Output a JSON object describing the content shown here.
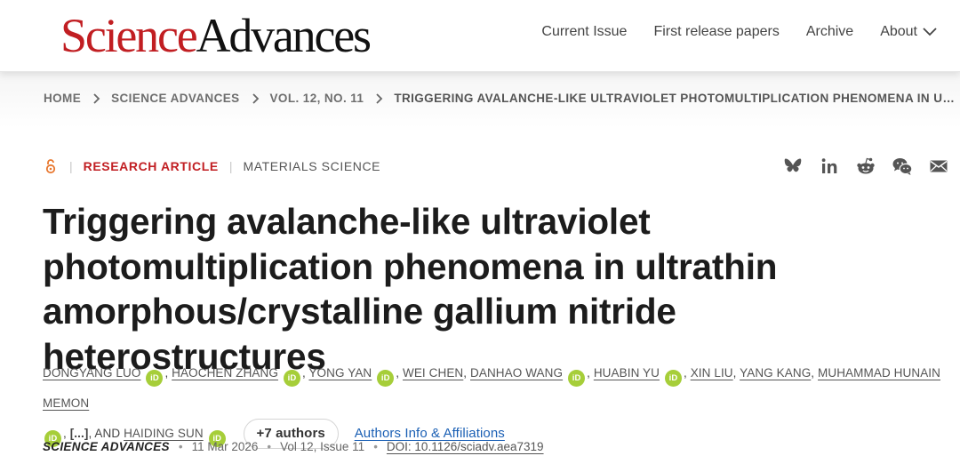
{
  "header": {
    "logo_part1": "Science",
    "logo_part2": "Advances",
    "nav": [
      "Current Issue",
      "First release papers",
      "Archive",
      "About"
    ],
    "brand_color": "#c11e22"
  },
  "breadcrumb": {
    "items": [
      "HOME",
      "SCIENCE ADVANCES",
      "VOL. 12, NO. 11",
      "TRIGGERING AVALANCHE-LIKE ULTRAVIOLET PHOTOMULTIPLICATION PHENOMENA IN ULTRATHIN…"
    ]
  },
  "article": {
    "access_icon": "open-access-icon",
    "type": "RESEARCH ARTICLE",
    "subject": "MATERIALS SCIENCE",
    "share_icons": [
      "bluesky-icon",
      "linkedin-icon",
      "reddit-icon",
      "wechat-icon",
      "email-icon"
    ],
    "title": "Triggering avalanche-like ultraviolet photomultiplication phenomena in ultrathin amorphous/crystalline gallium nitride heterostructures",
    "authors": [
      "DONGYANG LUO",
      "HAOCHEN ZHANG",
      "YONG YAN",
      "WEI CHEN",
      "DANHAO WANG",
      "HUABIN YU",
      "XIN LIU",
      "YANG KANG",
      "MUHAMMAD HUNAIN MEMON",
      "HAIDING SUN"
    ],
    "orcid_label": "iD",
    "ellipsis": "[...]",
    "and_text": ", AND",
    "more_authors": "+7 authors",
    "affiliations_link": "Authors Info & Affiliations",
    "orcid_color": "#a6ce39",
    "link_color": "#1a5fb4"
  },
  "citation": {
    "journal": "SCIENCE ADVANCES",
    "date": "11 Mar 2026",
    "volume": "Vol 12, Issue 11",
    "doi": "DOI: 10.1126/sciadv.aea7319"
  }
}
